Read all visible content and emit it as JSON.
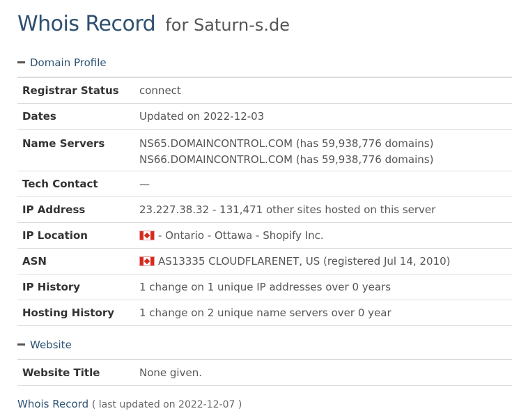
{
  "header": {
    "title_main": "Whois Record",
    "title_sub": "for Saturn-s.de"
  },
  "sections": {
    "domain_profile": {
      "label": "Domain Profile",
      "rows": {
        "registrar_status": {
          "key": "Registrar Status",
          "value": "connect"
        },
        "dates": {
          "key": "Dates",
          "value": "Updated on 2022-12-03"
        },
        "name_servers": {
          "key": "Name Servers",
          "value_1": "NS65.DOMAINCONTROL.COM (has 59,938,776 domains)",
          "value_2": "NS66.DOMAINCONTROL.COM (has 59,938,776 domains)"
        },
        "tech_contact": {
          "key": "Tech Contact",
          "value": "—"
        },
        "ip_address": {
          "key": "IP Address",
          "value": "23.227.38.32 - 131,471 other sites hosted on this server"
        },
        "ip_location": {
          "key": "IP Location",
          "value": "- Ontario - Ottawa - Shopify Inc.",
          "flag_icon": "canada-flag-icon"
        },
        "asn": {
          "key": "ASN",
          "value": "AS13335 CLOUDFLARENET, US (registered Jul 14, 2010)",
          "flag_icon": "canada-flag-icon"
        },
        "ip_history": {
          "key": "IP History",
          "value": "1 change on 1 unique IP addresses over 0 years"
        },
        "hosting_history": {
          "key": "Hosting History",
          "value": "1 change on 2 unique name servers over 0 year"
        }
      }
    },
    "website": {
      "label": "Website",
      "rows": {
        "website_title": {
          "key": "Website Title",
          "value": "None given."
        }
      }
    }
  },
  "footer": {
    "link_label": "Whois Record",
    "meta": "( last updated on 2022-12-07 )"
  },
  "colors": {
    "title": "#2e4f6f",
    "link": "#2e5373",
    "row_border": "#dcdcdc",
    "flag_red": "#d52b1e"
  }
}
